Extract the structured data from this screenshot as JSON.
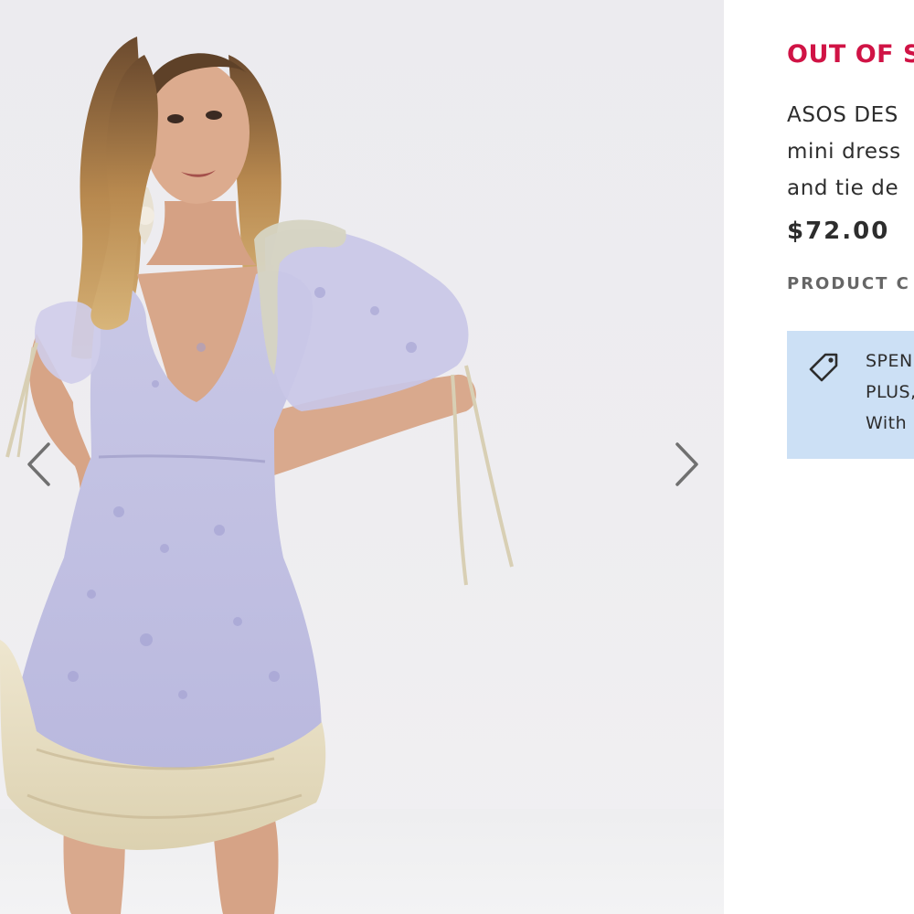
{
  "product": {
    "stock_status": "OUT OF S",
    "title_lines": [
      "ASOS DES",
      "mini dress",
      "and tie de"
    ],
    "price": "$72.00",
    "details_link": "PRODUCT C"
  },
  "promo": {
    "lines": [
      "SPEN",
      "PLUS,",
      "With"
    ],
    "icon": "price-tag-icon"
  },
  "gallery": {
    "prev_icon": "chevron-left-icon",
    "next_icon": "chevron-right-icon"
  },
  "colors": {
    "stock_status": "#d01345",
    "promo_background": "#cce0f5",
    "text": "#2d2d2d",
    "muted_text": "#666666"
  }
}
